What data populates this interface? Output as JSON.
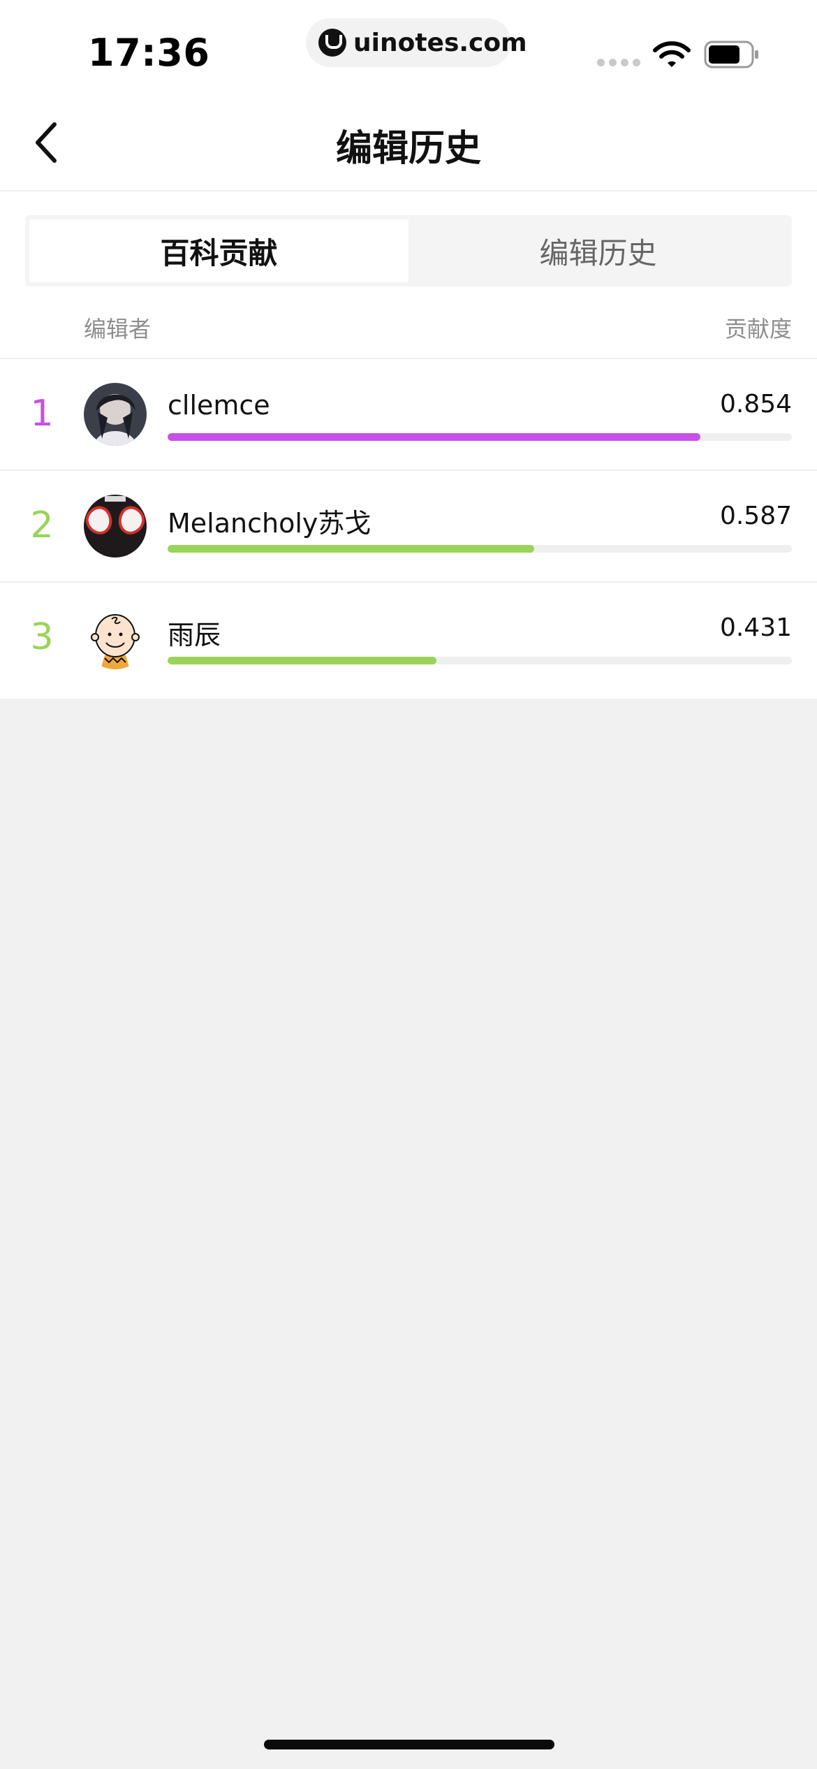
{
  "status_bar": {
    "time": "17:36",
    "url": "uinotes.com",
    "wifi_icon": "wifi-icon",
    "battery_icon": "battery-icon"
  },
  "nav": {
    "back_icon": "chevron-left-icon",
    "title": "编辑历史"
  },
  "tabs": [
    {
      "label": "百科贡献",
      "active": true
    },
    {
      "label": "编辑历史",
      "active": false
    }
  ],
  "columns": {
    "editor": "编辑者",
    "contribution": "贡献度"
  },
  "colors": {
    "rank1": "#c850e6",
    "rank_other": "#9ad35a"
  },
  "contributors": [
    {
      "rank": "1",
      "name": "cllemce",
      "score": "0.854",
      "fraction": 0.854,
      "color": "#c850e6"
    },
    {
      "rank": "2",
      "name": "Melancholy苏戈",
      "score": "0.587",
      "fraction": 0.587,
      "color": "#9ad35a"
    },
    {
      "rank": "3",
      "name": "雨辰",
      "score": "0.431",
      "fraction": 0.431,
      "color": "#9ad35a"
    }
  ]
}
